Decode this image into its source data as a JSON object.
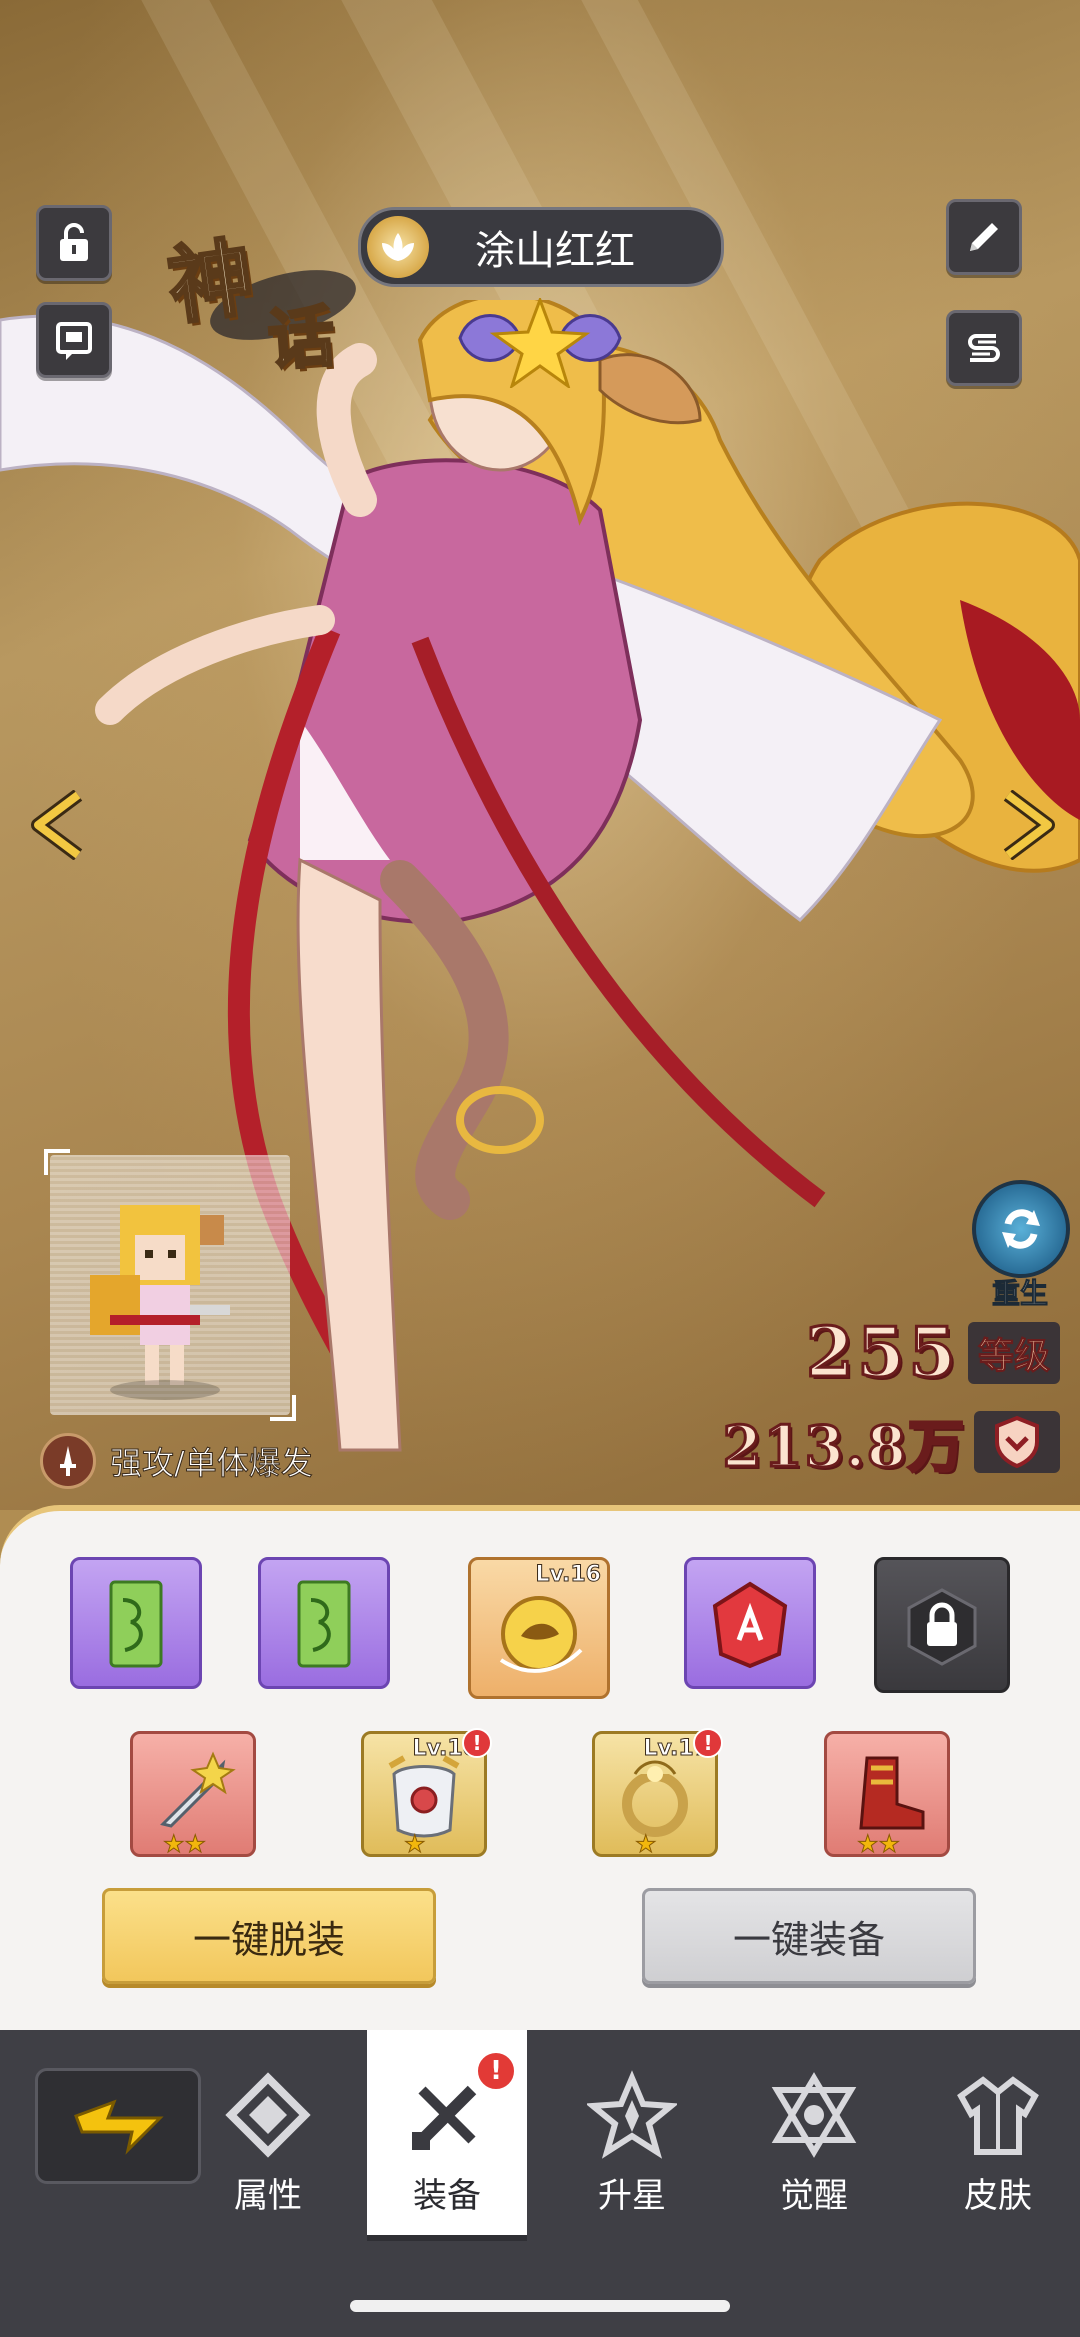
{
  "character": {
    "name": "涂山红红",
    "rarity_label": "神话",
    "role": "强攻/单体爆发",
    "level": "255",
    "level_label": "等级",
    "power": "213.8万",
    "reborn_label": "重生"
  },
  "equipment": {
    "row1": [
      {
        "type": "talisman",
        "frame": "purple",
        "level": ""
      },
      {
        "type": "talisman",
        "frame": "purple",
        "level": ""
      },
      {
        "type": "golden-orb",
        "frame": "orange",
        "level": "Lv.16"
      },
      {
        "type": "red-gem",
        "frame": "purple",
        "level": ""
      },
      {
        "type": "locked",
        "frame": "gray",
        "level": ""
      }
    ],
    "row2": [
      {
        "type": "weapon",
        "frame": "red",
        "level": "",
        "stars": "★★",
        "alert": false
      },
      {
        "type": "armor",
        "frame": "gold",
        "level": "Lv.10",
        "stars": "★",
        "alert": true
      },
      {
        "type": "ring",
        "frame": "gold",
        "level": "Lv.17",
        "stars": "★",
        "alert": true
      },
      {
        "type": "boots",
        "frame": "red",
        "level": "",
        "stars": "★★",
        "alert": false
      }
    ],
    "unequip_all": "一键脱装",
    "equip_all": "一键装备"
  },
  "nav": {
    "tabs": [
      {
        "label": "属性",
        "icon": "attributes-icon",
        "active": false
      },
      {
        "label": "装备",
        "icon": "equipment-icon",
        "active": true,
        "badge": "!"
      },
      {
        "label": "升星",
        "icon": "star-up-icon",
        "active": false
      },
      {
        "label": "觉醒",
        "icon": "awaken-icon",
        "active": false
      },
      {
        "label": "皮肤",
        "icon": "skin-icon",
        "active": false
      }
    ]
  },
  "colors": {
    "accent_gold": "#f2c75c",
    "panel_bg": "#f5f3f2",
    "nav_bg": "#3f3f45",
    "alert_red": "#e23a36"
  }
}
